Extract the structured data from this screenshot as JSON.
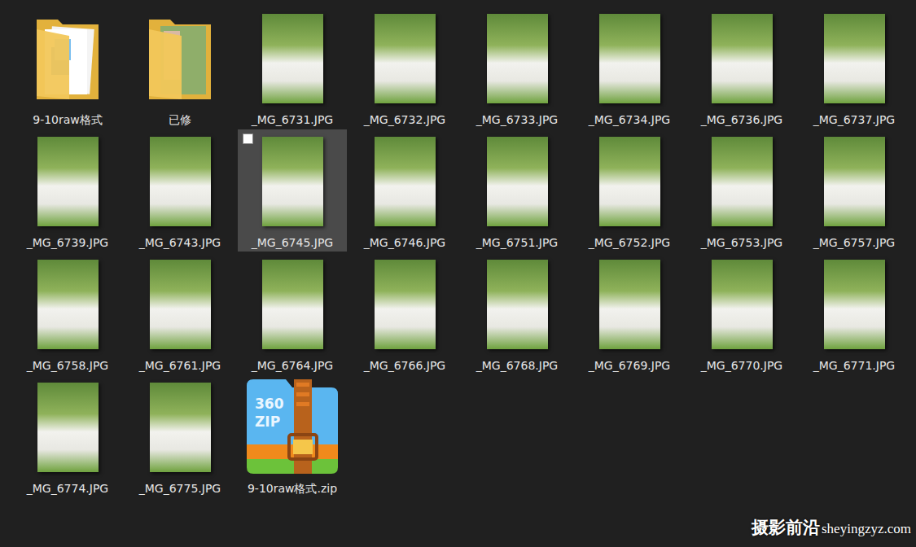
{
  "items": [
    {
      "name": "9-10raw格式",
      "kind": "folder",
      "selected": false,
      "checked": false
    },
    {
      "name": "已修",
      "kind": "folder-preview",
      "selected": false,
      "checked": false
    },
    {
      "name": "_MG_6731.JPG",
      "kind": "image",
      "selected": false,
      "checked": false
    },
    {
      "name": "_MG_6732.JPG",
      "kind": "image",
      "selected": false,
      "checked": false
    },
    {
      "name": "_MG_6733.JPG",
      "kind": "image",
      "selected": false,
      "checked": false
    },
    {
      "name": "_MG_6734.JPG",
      "kind": "image",
      "selected": false,
      "checked": false
    },
    {
      "name": "_MG_6736.JPG",
      "kind": "image",
      "selected": false,
      "checked": false
    },
    {
      "name": "_MG_6737.JPG",
      "kind": "image",
      "selected": false,
      "checked": false
    },
    {
      "name": "_MG_6739.JPG",
      "kind": "image",
      "selected": false,
      "checked": false
    },
    {
      "name": "_MG_6743.JPG",
      "kind": "image",
      "selected": false,
      "checked": false
    },
    {
      "name": "_MG_6745.JPG",
      "kind": "image",
      "selected": true,
      "checked": false
    },
    {
      "name": "_MG_6746.JPG",
      "kind": "image",
      "selected": false,
      "checked": false
    },
    {
      "name": "_MG_6751.JPG",
      "kind": "image",
      "selected": false,
      "checked": false
    },
    {
      "name": "_MG_6752.JPG",
      "kind": "image",
      "selected": false,
      "checked": false
    },
    {
      "name": "_MG_6753.JPG",
      "kind": "image",
      "selected": false,
      "checked": false
    },
    {
      "name": "_MG_6757.JPG",
      "kind": "image",
      "selected": false,
      "checked": false
    },
    {
      "name": "_MG_6758.JPG",
      "kind": "image",
      "selected": false,
      "checked": false
    },
    {
      "name": "_MG_6761.JPG",
      "kind": "image",
      "selected": false,
      "checked": false
    },
    {
      "name": "_MG_6764.JPG",
      "kind": "image",
      "selected": false,
      "checked": false
    },
    {
      "name": "_MG_6766.JPG",
      "kind": "image",
      "selected": false,
      "checked": false
    },
    {
      "name": "_MG_6768.JPG",
      "kind": "image",
      "selected": false,
      "checked": false
    },
    {
      "name": "_MG_6769.JPG",
      "kind": "image",
      "selected": false,
      "checked": false
    },
    {
      "name": "_MG_6770.JPG",
      "kind": "image",
      "selected": false,
      "checked": false
    },
    {
      "name": "_MG_6771.JPG",
      "kind": "image",
      "selected": false,
      "checked": false
    },
    {
      "name": "_MG_6774.JPG",
      "kind": "image",
      "selected": false,
      "checked": false
    },
    {
      "name": "_MG_6775.JPG",
      "kind": "image",
      "selected": false,
      "checked": false
    },
    {
      "name": "9-10raw格式.zip",
      "kind": "archive",
      "selected": false,
      "checked": false,
      "icon_text": [
        "360",
        "ZIP"
      ]
    }
  ],
  "watermark": {
    "title": "摄影前沿",
    "url": "sheyingzyz.com"
  }
}
